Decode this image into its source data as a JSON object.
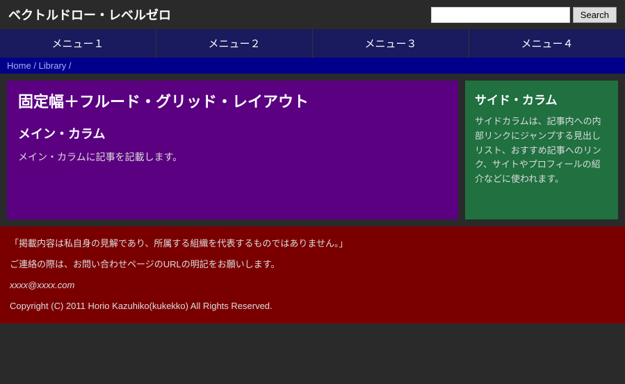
{
  "header": {
    "site_title": "ベクトルドロー・レベルゼロ",
    "search_placeholder": "",
    "search_button_label": "Search"
  },
  "nav": {
    "items": [
      {
        "label": "メニュー１"
      },
      {
        "label": "メニュー２"
      },
      {
        "label": "メニュー３"
      },
      {
        "label": "メニュー４"
      }
    ]
  },
  "breadcrumb": {
    "home_label": "Home",
    "separator": "/",
    "library_label": "Library",
    "separator2": "/"
  },
  "main": {
    "article_title": "固定幅＋フルード・グリッド・レイアウト",
    "section_heading": "メイン・カラム",
    "section_text": "メイン・カラムに記事を記載します。"
  },
  "sidebar": {
    "title": "サイド・カラム",
    "text": "サイドカラムは、記事内への内部リンクにジャンプする見出しリスト、おすすめ記事へのリンク、サイトやプロフィールの紹介などに使われます。"
  },
  "footer": {
    "disclaimer": "「掲載内容は私自身の見解であり、所属する組織を代表するものではありません。」",
    "contact": "ご連絡の際は、お問い合わせページのURLの明記をお願いします。",
    "email": "xxxx@xxxx.com",
    "copyright": "Copyright (C) 2011 Horio Kazuhiko(kukekko) All Rights Reserved."
  }
}
